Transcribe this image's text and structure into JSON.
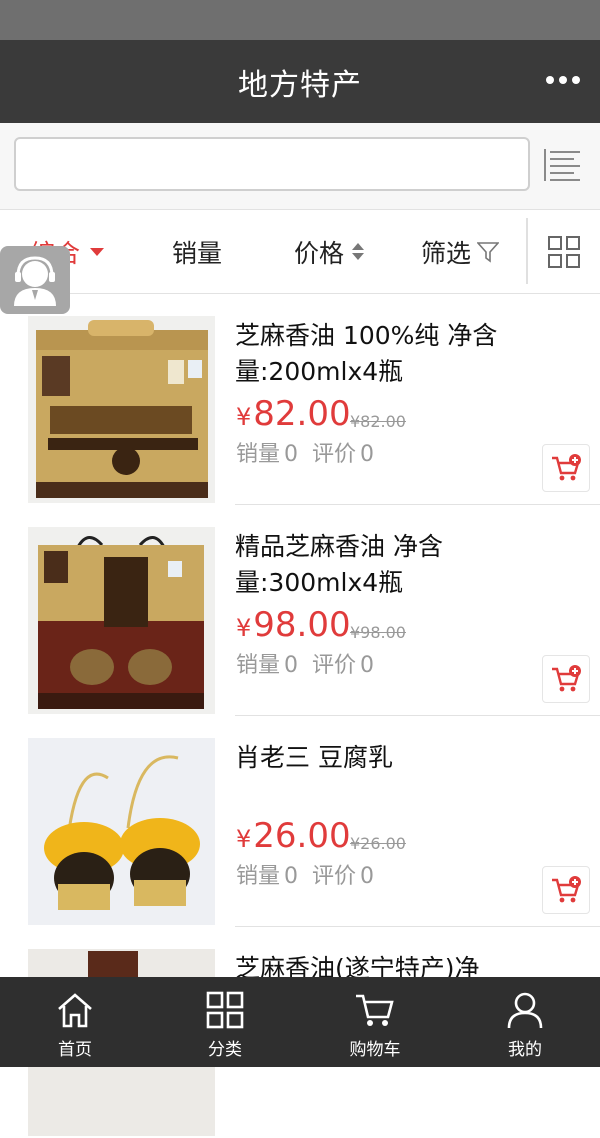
{
  "header": {
    "title": "地方特产"
  },
  "search": {
    "value": "",
    "placeholder": ""
  },
  "filters": [
    {
      "label": "综合",
      "active": true
    },
    {
      "label": "销量",
      "active": false
    },
    {
      "label": "价格",
      "active": false
    },
    {
      "label": "筛选",
      "active": false
    }
  ],
  "products": [
    {
      "name": "芝麻香油 100%纯 净含量:200mlx4瓶",
      "currency": "¥",
      "price": "82.00",
      "old_price": "¥82.00",
      "sales_label": "销量",
      "sales": "0",
      "reviews_label": "评价",
      "reviews": "0",
      "image": "boxed sesame oil gift box"
    },
    {
      "name": "精品芝麻香油 净含量:300mlx4瓶",
      "currency": "¥",
      "price": "98.00",
      "old_price": "¥98.00",
      "sales_label": "销量",
      "sales": "0",
      "reviews_label": "评价",
      "reviews": "0",
      "image": "premium sesame oil gift bag"
    },
    {
      "name": "肖老三 豆腐乳",
      "currency": "¥",
      "price": "26.00",
      "old_price": "¥26.00",
      "sales_label": "销量",
      "sales": "0",
      "reviews_label": "评价",
      "reviews": "0",
      "image": "two tofu jars in bamboo baskets"
    },
    {
      "name": "芝麻香油(遂宁特产)净",
      "currency": "¥",
      "price": "",
      "old_price": "",
      "sales_label": "",
      "sales": "",
      "reviews_label": "",
      "reviews": "",
      "image": "partially visible product"
    }
  ],
  "tabbar": [
    {
      "label": "首页",
      "icon": "home-icon"
    },
    {
      "label": "分类",
      "icon": "grid-icon"
    },
    {
      "label": "购物车",
      "icon": "cart-icon"
    },
    {
      "label": "我的",
      "icon": "user-icon"
    }
  ],
  "colors": {
    "accent": "#e03b3b",
    "header_bg": "#3a3a3a",
    "tabbar_bg": "#2f2f2f"
  }
}
